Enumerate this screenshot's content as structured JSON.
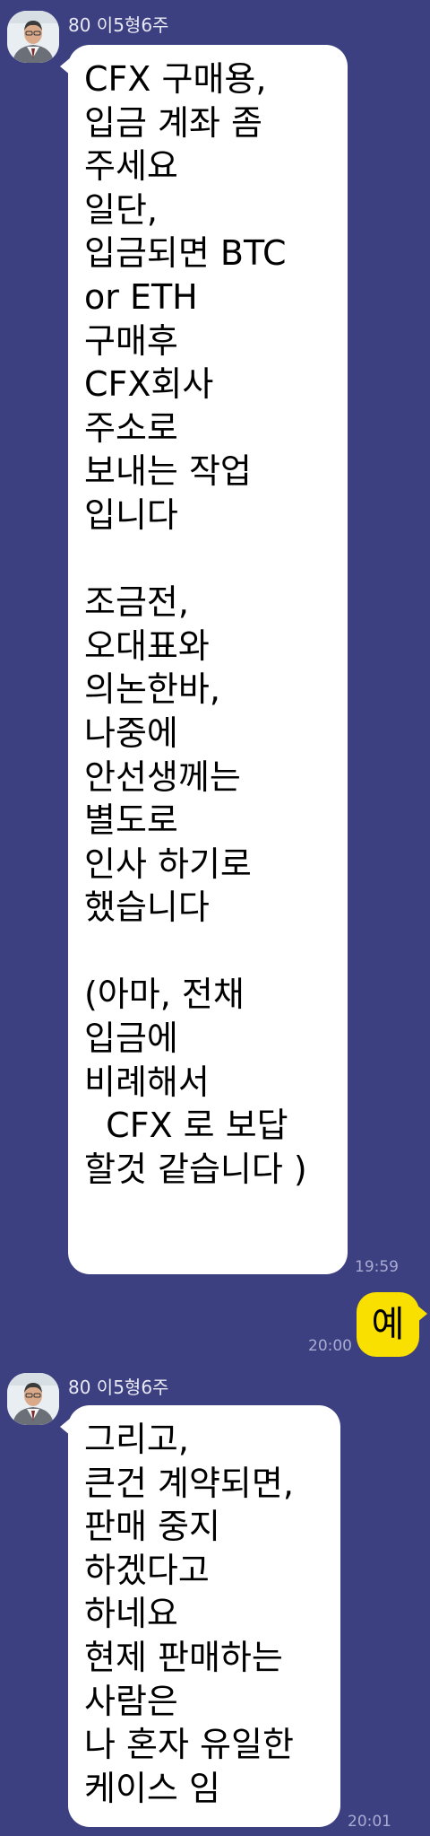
{
  "colors": {
    "background": "#3c3f80",
    "incoming_bubble": "#ffffff",
    "outgoing_bubble": "#f9e000",
    "timestamp": "#a9acd2"
  },
  "messages": [
    {
      "sender": "80 이5형6주",
      "text": "CFX 구매용,\n입금 계좌 좀\n주세요\n일단,\n입금되면 BTC\nor ETH\n구매후\nCFX회사\n주소로\n보내는 작업\n입니다\n\n조금전,\n오대표와\n의논한바,\n나중에\n안선생께는\n별도로\n인사 하기로\n했습니다\n\n(아마, 전채\n입금에\n비례해서\n  CFX 로 보답\n할것 같습니다 )",
      "time": "19:59"
    },
    {
      "text": "예",
      "time": "20:00"
    },
    {
      "sender": "80 이5형6주",
      "text": "그리고,\n큰건 계약되면,\n판매 중지\n하겠다고\n하네요\n현제 판매하는\n사람은\n나 혼자 유일한\n케이스 임",
      "time": "20:01"
    }
  ]
}
